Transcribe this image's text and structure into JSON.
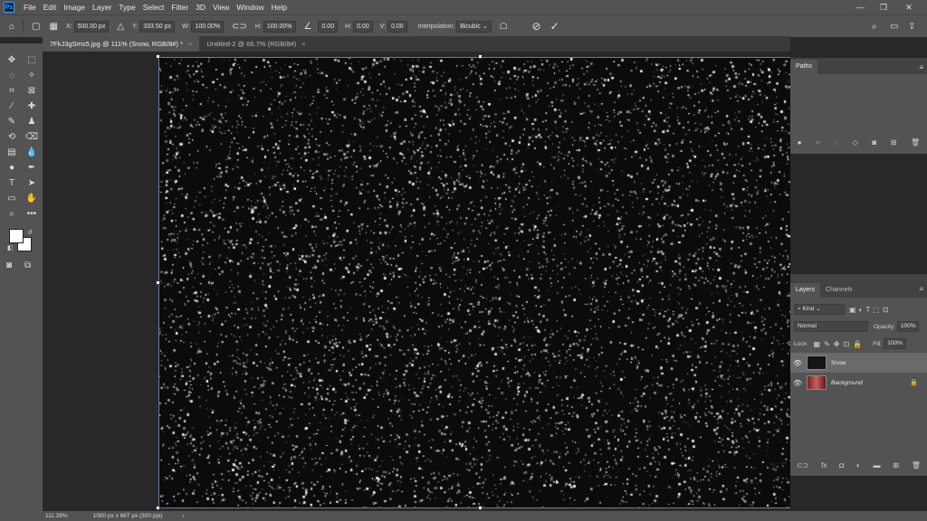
{
  "app": {
    "logo": "Ps",
    "window_controls": [
      "—",
      "❐",
      "✕"
    ]
  },
  "menu": [
    "File",
    "Edit",
    "Image",
    "Layer",
    "Type",
    "Select",
    "Filter",
    "3D",
    "View",
    "Window",
    "Help"
  ],
  "options": {
    "x_label": "X:",
    "x_value": "500.00 px",
    "y_label": "Y:",
    "y_value": "333.50 px",
    "w_label": "W:",
    "w_value": "100.00%",
    "h_label": "H:",
    "h_value": "100.00%",
    "angle_value": "0.00",
    "hskew_label": "H:",
    "hskew_value": "0.00",
    "vskew_label": "V:",
    "vskew_value": "0.00",
    "interpolation_label": "Interpolation:",
    "interpolation_value": "Bicubic"
  },
  "tabs": [
    {
      "label": "7FkJ3gSms5.jpg @ 111% (Snow, RGB/8#) *",
      "close": "×"
    },
    {
      "label": "Untitled-2 @ 66.7% (RGB/8#)",
      "close": "×"
    }
  ],
  "paths_panel": {
    "tab": "Paths",
    "icons": [
      "●",
      "○",
      "◌",
      "◇",
      "◙",
      "⊞",
      "🗑"
    ]
  },
  "layers_panel": {
    "tabs": [
      "Layers",
      "Channels"
    ],
    "filter_kind": "Kind",
    "blend_mode": "Normal",
    "opacity_label": "Opacity:",
    "opacity_value": "100%",
    "lock_label": "Lock:",
    "fill_label": "Fill:",
    "fill_value": "100%",
    "layers": [
      {
        "name": "Snow",
        "selected": true
      },
      {
        "name": "Background",
        "selected": false,
        "locked": true
      }
    ],
    "footer_icons": [
      "⊂⊃",
      "fx",
      "◘",
      "◐",
      "▬",
      "⊞",
      "🗑"
    ]
  },
  "status": {
    "zoom": "111.39%",
    "doc_info": "1000 px x 667 px (300 ppi)",
    "arrow": "›"
  },
  "colors": {
    "ui_panel": "#535353",
    "ui_dark": "#282828",
    "accent": "#31a8ff",
    "selection": "#5f7ea8"
  }
}
